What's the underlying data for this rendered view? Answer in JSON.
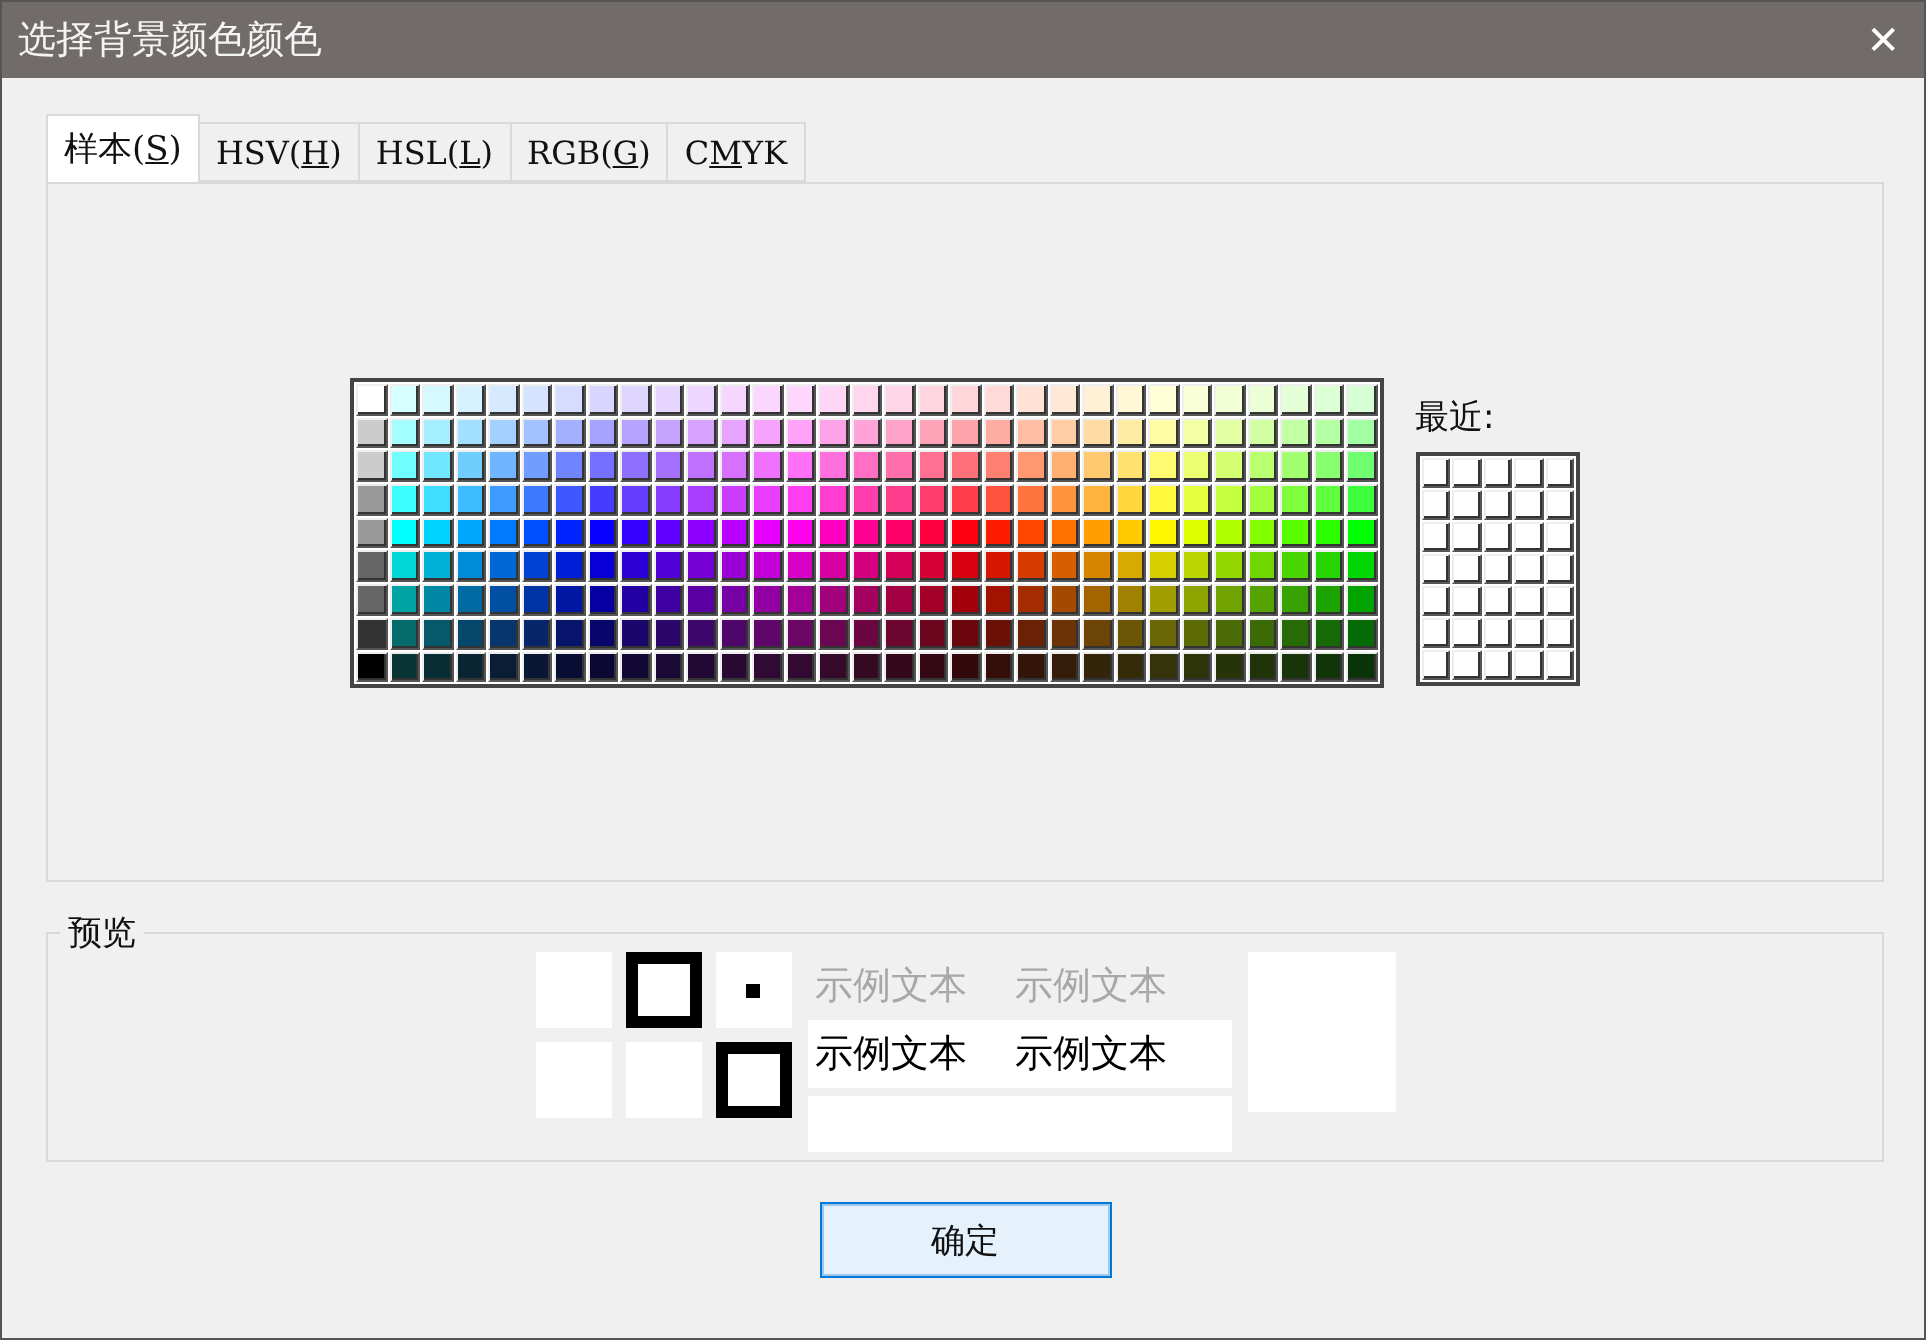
{
  "window": {
    "title": "选择背景颜色颜色",
    "close": "✕"
  },
  "tabs": [
    {
      "before": "样本(",
      "key": "S",
      "after": ")",
      "selected": true
    },
    {
      "before": "HSV(",
      "key": "H",
      "after": ")",
      "selected": false
    },
    {
      "before": "HSL(",
      "key": "L",
      "after": ")",
      "selected": false
    },
    {
      "before": "RGB(",
      "key": "G",
      "after": ")",
      "selected": false
    },
    {
      "before": "C",
      "key": "M",
      "after": "YK",
      "selected": false
    }
  ],
  "recent": {
    "label": "最近:"
  },
  "preview": {
    "legend": "预览",
    "light_texts": [
      "示例文本",
      "示例文本"
    ],
    "dark_texts": [
      "示例文本",
      "示例文本"
    ]
  },
  "buttons": [
    "确定"
  ]
}
